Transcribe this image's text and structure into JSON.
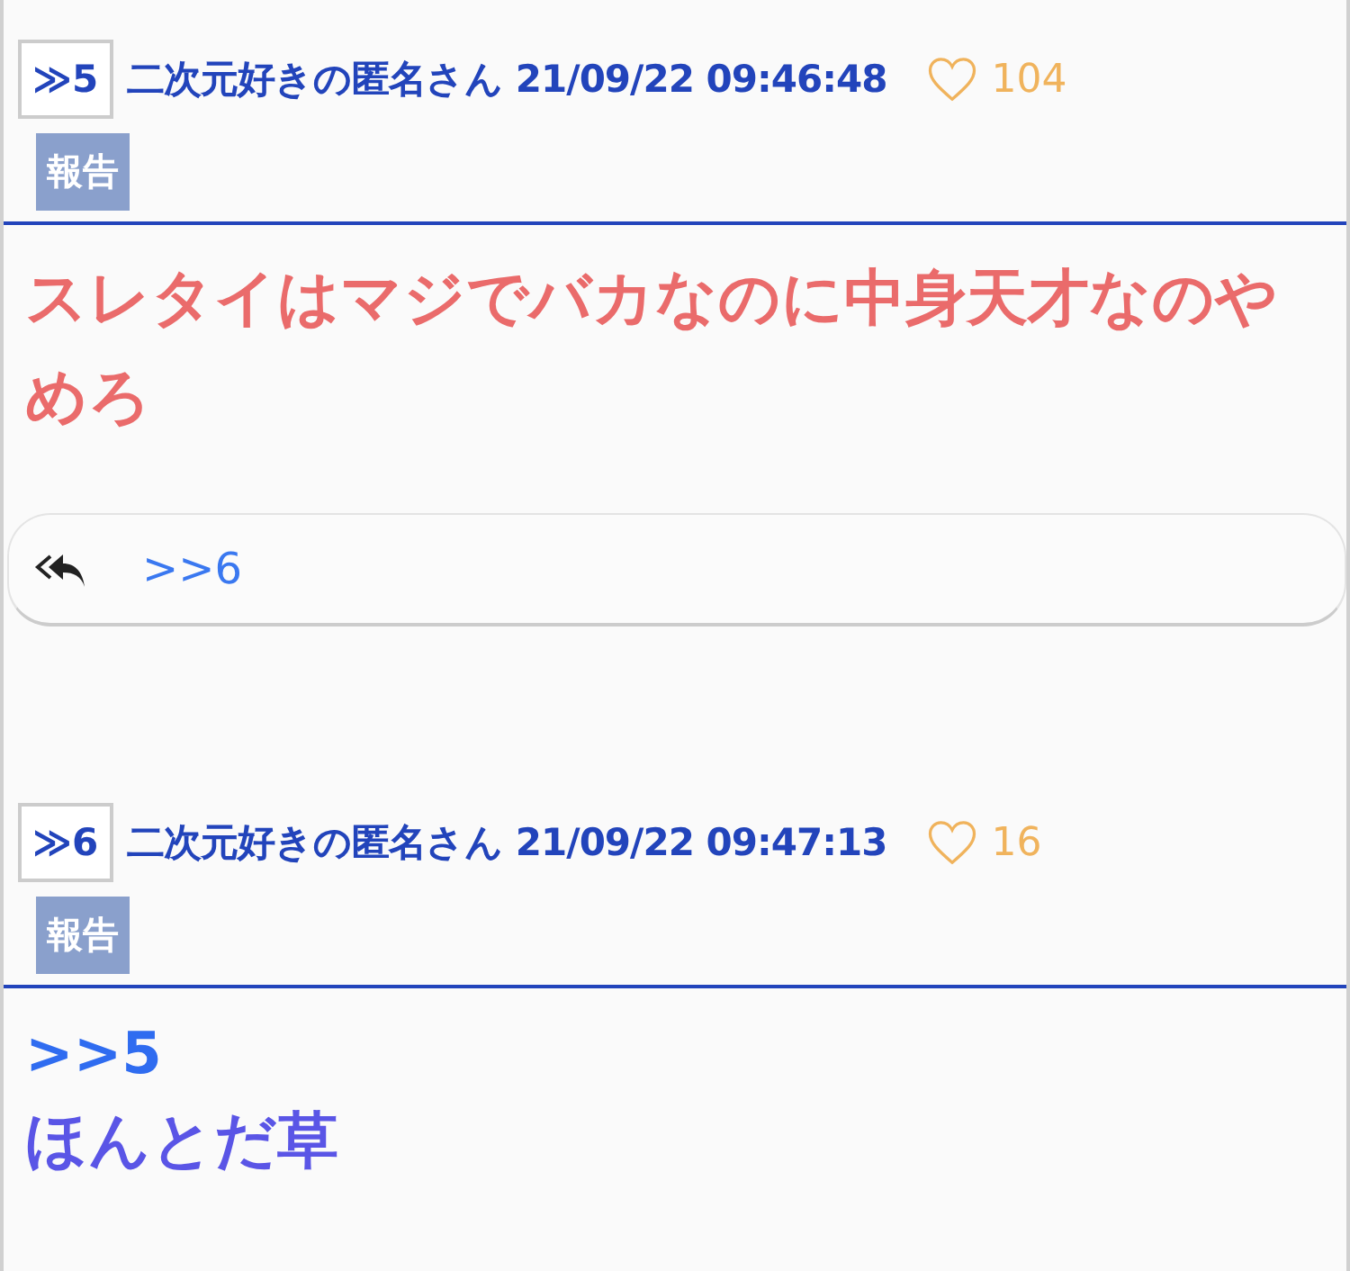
{
  "posts": [
    {
      "number": "≫5",
      "name": "二次元好きの匿名さん",
      "date": "21/09/22 09:46:48",
      "likes": "104",
      "report": "報告",
      "body": [
        {
          "kind": "text",
          "text": "スレタイはマジでバカなのに中身天才なのやめろ",
          "color": "#ea6b6b"
        }
      ],
      "replies": [
        ">>6"
      ]
    },
    {
      "number": "≫6",
      "name": "二次元好きの匿名さん",
      "date": "21/09/22 09:47:13",
      "likes": "16",
      "report": "報告",
      "body": [
        {
          "kind": "anchor",
          "text": ">>5",
          "color": "#2f6cf0"
        },
        {
          "kind": "text",
          "text": "ほんとだ草",
          "color": "#5a55e6"
        }
      ]
    }
  ]
}
